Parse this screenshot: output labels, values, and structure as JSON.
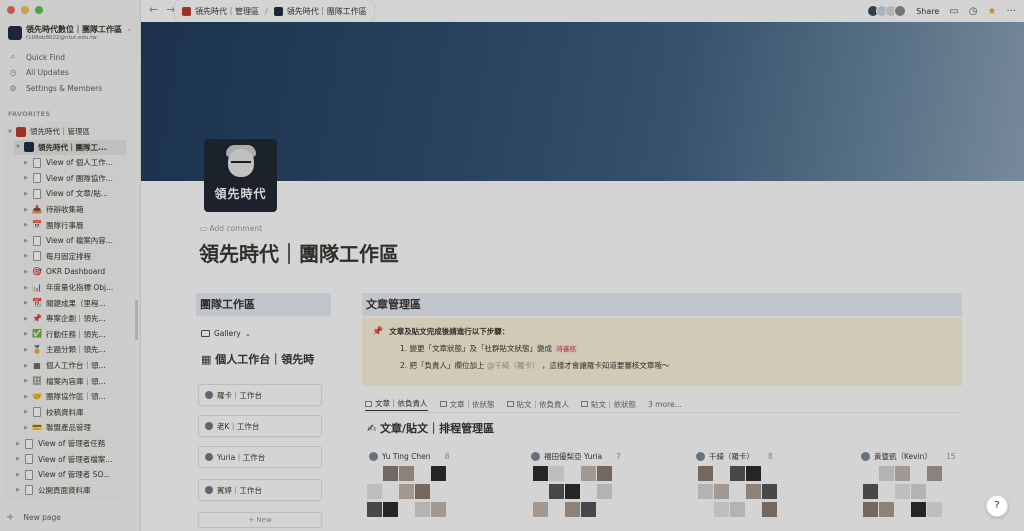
{
  "workspace": {
    "name": "領先時代數位｜團隊工作區",
    "email": "t108ab8022@ntut.edu.tw"
  },
  "sidebar": {
    "nav": [
      {
        "icon": "search-icon",
        "label": "Quick Find"
      },
      {
        "icon": "clock-icon",
        "label": "All Updates"
      },
      {
        "icon": "gear-icon",
        "label": "Settings & Members"
      }
    ],
    "favorites_label": "FAVORITES",
    "tree": [
      {
        "label": "領先時代｜管理區",
        "icon": "person-icon",
        "glyph": "",
        "level": 0
      },
      {
        "label": "領先時代｜團隊工...",
        "icon": "workspace-logo-icon",
        "glyph": "",
        "level": 1
      },
      {
        "label": "View of 個人工作...",
        "icon": "page-icon",
        "glyph": "",
        "level": 2
      },
      {
        "label": "View of 團隊協作...",
        "icon": "page-icon",
        "glyph": "",
        "level": 2
      },
      {
        "label": "View of 文章/貼...",
        "icon": "page-icon",
        "glyph": "",
        "level": 2
      },
      {
        "label": "待辦收集箱",
        "icon": "inbox-icon",
        "glyph": "📥",
        "level": 2
      },
      {
        "label": "團隊行事曆",
        "icon": "calendar-icon",
        "glyph": "📅",
        "level": 2
      },
      {
        "label": "View of 檔案內容...",
        "icon": "page-icon",
        "glyph": "",
        "level": 2
      },
      {
        "label": "每月固定排程",
        "icon": "page-icon",
        "glyph": "",
        "level": 2
      },
      {
        "label": "OKR Dashboard",
        "icon": "target-icon",
        "glyph": "🎯",
        "level": 2
      },
      {
        "label": "年度量化指標 Obj...",
        "icon": "bar-chart-icon",
        "glyph": "📊",
        "level": 2
      },
      {
        "label": "關鍵成果（里程...",
        "icon": "calendar-icon",
        "glyph": "📆",
        "level": 2
      },
      {
        "label": "專案企劃｜領先...",
        "icon": "pushpin-icon",
        "glyph": "📌",
        "level": 2
      },
      {
        "label": "行動任務｜領先...",
        "icon": "checkbox-icon",
        "glyph": "✅",
        "level": 2
      },
      {
        "label": "主題分類｜領先...",
        "icon": "medal-icon",
        "glyph": "🏅",
        "level": 2
      },
      {
        "label": "個人工作台｜領...",
        "icon": "grid-icon",
        "glyph": "▦",
        "level": 2
      },
      {
        "label": "檔案內容庫｜領...",
        "icon": "cabinet-icon",
        "glyph": "🗄",
        "level": 2
      },
      {
        "label": "團隊協作區｜領...",
        "icon": "handshake-icon",
        "glyph": "🤝",
        "level": 2
      },
      {
        "label": "校稿資料庫",
        "icon": "page-icon",
        "glyph": "",
        "level": 2
      },
      {
        "label": "聯盟產品管理",
        "icon": "card-icon",
        "glyph": "💳",
        "level": 2
      },
      {
        "label": "View of 管理者任務",
        "icon": "page-icon",
        "glyph": "",
        "level": 1
      },
      {
        "label": "View of 管理者檔案...",
        "icon": "page-icon",
        "glyph": "",
        "level": 1
      },
      {
        "label": "View of 管理者 SO...",
        "icon": "page-icon",
        "glyph": "",
        "level": 1
      },
      {
        "label": "公開頁面資料庫",
        "icon": "page-icon",
        "glyph": "",
        "level": 1
      }
    ],
    "new_page": "New page"
  },
  "topbar": {
    "breadcrumb": [
      "領先時代｜管理區",
      "領先時代｜團隊工作區"
    ],
    "share": "Share"
  },
  "page": {
    "icon_text": "領先時代",
    "add_comment": "Add comment",
    "title": "領先時代｜團隊工作區"
  },
  "left_col": {
    "title": "團隊工作區",
    "view": "Gallery",
    "gallery_heading": "個人工作台｜領先時",
    "cards": [
      "羅卡｜工作台",
      "老K｜工作台",
      "Yuria｜工作台",
      "賓婷｜工作台"
    ],
    "new": "+ New"
  },
  "right_col": {
    "title": "文章管理區",
    "callout_heading": "文章及貼文完成後請進行以下步驟：",
    "step1_a": "1.  變更「文章狀態」及「社群貼文狀態」變成",
    "step1_tag": "待審核",
    "step2_a": "2.  把「負責人」欄位加上",
    "step2_mention": "@千綺（羅卡）",
    "step2_b": "，這樣才會讓羅卡知道要審核文章哦〜",
    "views": [
      "文章｜依負責人",
      "文章｜依狀態",
      "貼文｜依負責人",
      "貼文｜依狀態",
      "3 more..."
    ],
    "board_title": "文章/貼文｜排程管理區",
    "columns": [
      {
        "name": "Yu Ting Chen",
        "count": "8"
      },
      {
        "name": "福田優梨亞 Yuria",
        "count": "7"
      },
      {
        "name": "千綺（羅卡）",
        "count": "8"
      },
      {
        "name": "黃豐凱（Kevin）",
        "count": "15"
      }
    ]
  },
  "colors": {
    "accent": "#e7eef5",
    "callout": "#fbf3db",
    "tag_red": "#c44"
  },
  "help": "?"
}
